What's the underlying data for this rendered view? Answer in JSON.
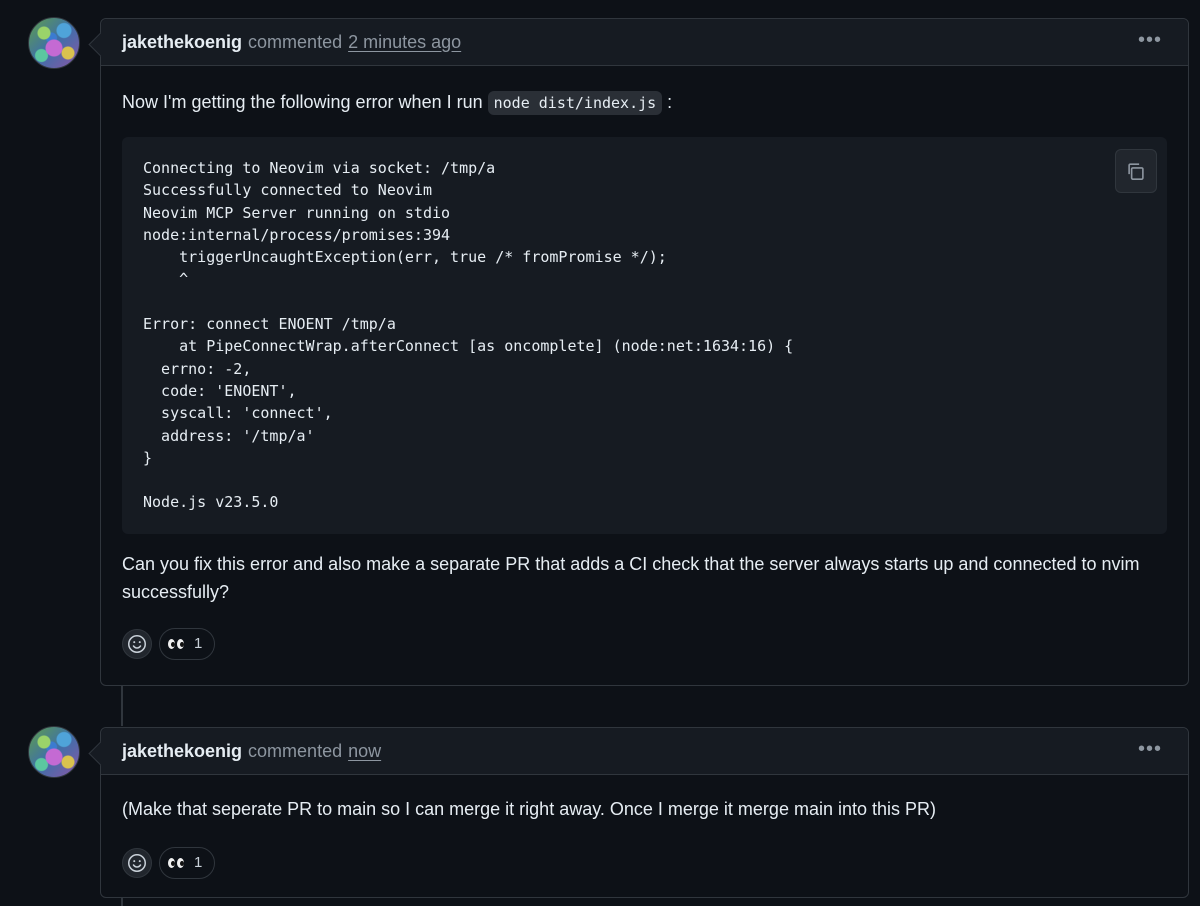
{
  "comments": [
    {
      "author": "jakethekoenig",
      "action": "commented",
      "time": "2 minutes ago",
      "intro_before": "Now I'm getting the following error when I run ",
      "intro_code": "node dist/index.js",
      "intro_after": " :",
      "code_block": "Connecting to Neovim via socket: /tmp/a\nSuccessfully connected to Neovim\nNeovim MCP Server running on stdio\nnode:internal/process/promises:394\n    triggerUncaughtException(err, true /* fromPromise */);\n    ^\n\nError: connect ENOENT /tmp/a\n    at PipeConnectWrap.afterConnect [as oncomplete] (node:net:1634:16) {\n  errno: -2,\n  code: 'ENOENT',\n  syscall: 'connect',\n  address: '/tmp/a'\n}\n\nNode.js v23.5.0",
      "followup": "Can you fix this error and also make a separate PR that adds a CI check that the server always starts up and connected to nvim successfully?",
      "reaction_count": "1"
    },
    {
      "author": "jakethekoenig",
      "action": "commented",
      "time": "now",
      "text": "(Make that seperate PR to main so I can merge it right away. Once I merge it merge main into this PR)",
      "reaction_count": "1"
    }
  ],
  "icons": {
    "menu": "kebab-horizontal-icon",
    "copy": "copy-icon",
    "add_reaction": "smiley-icon",
    "reaction": "eyes-emoji"
  },
  "colors": {
    "background": "#0d1117",
    "header": "#161b22",
    "border": "#30363d",
    "muted": "#8d96a0"
  }
}
